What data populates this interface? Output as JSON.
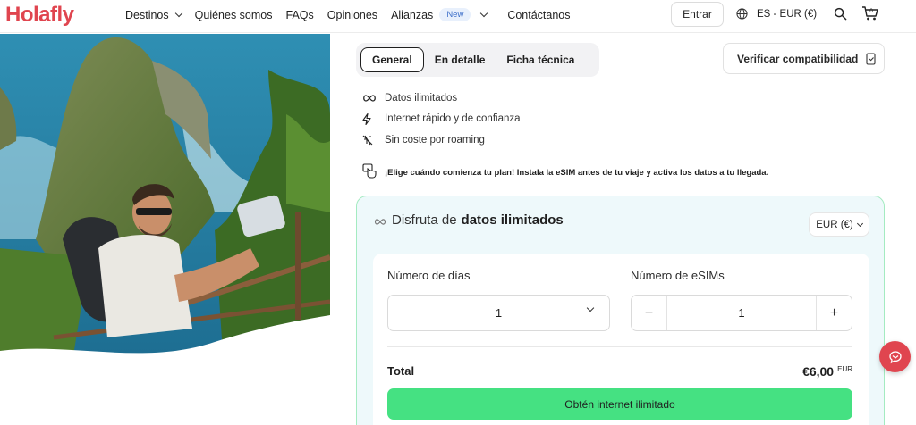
{
  "header": {
    "logo": "Holafly",
    "nav": {
      "destinos": "Destinos",
      "quienes": "Quiénes somos",
      "faqs": "FAQs",
      "opiniones": "Opiniones",
      "alianzas": "Alianzas",
      "alianzas_badge": "New",
      "contacto": "Contáctanos"
    },
    "login": "Entrar",
    "language": "ES - EUR (€)",
    "cart_count": "0"
  },
  "tabs": {
    "general": "General",
    "detalle": "En detalle",
    "ficha": "Ficha técnica",
    "active": "General"
  },
  "compat_button": "Verificar compatibilidad",
  "features": [
    {
      "icon": "infinity-icon",
      "text": "Datos ilimitados"
    },
    {
      "icon": "lightning-icon",
      "text": "Internet rápido y de confianza"
    },
    {
      "icon": "no-roaming-icon",
      "text": "Sin coste por roaming"
    }
  ],
  "tip": "¡Elige cuándo comienza tu plan! Instala la eSIM antes de tu viaje y activa los datos a tu llegada.",
  "plan": {
    "title_prefix": "Disfruta de",
    "title_bold": "datos ilimitados",
    "currency": "EUR (€)",
    "days_label": "Número de días",
    "days_value": "1",
    "esims_label": "Número de eSIMs",
    "esims_value": "1",
    "minus": "−",
    "plus": "+",
    "total_label": "Total",
    "total_value": "€6,00",
    "total_currency": "EUR",
    "cta": "Obtén internet ilimitado"
  },
  "colors": {
    "brand": "#e0454f",
    "cta": "#45e182",
    "card_bg": "#eef9fb",
    "card_border": "#a4ebc1"
  }
}
